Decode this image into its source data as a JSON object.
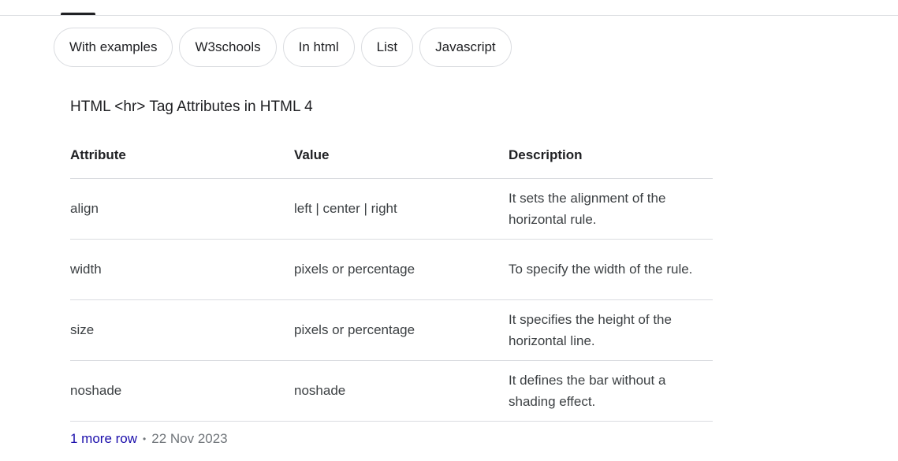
{
  "chips": [
    "With examples",
    "W3schools",
    "In html",
    "List",
    "Javascript"
  ],
  "heading": "HTML <hr> Tag Attributes in HTML 4",
  "table": {
    "headers": [
      "Attribute",
      "Value",
      "Description"
    ],
    "rows": [
      {
        "attribute": "align",
        "value": "left | center | right",
        "description": "It sets the alignment of the horizontal rule."
      },
      {
        "attribute": "width",
        "value": "pixels or percentage",
        "description": "To specify the width of the rule."
      },
      {
        "attribute": "size",
        "value": "pixels or percentage",
        "description": "It specifies the height of the horizontal line."
      },
      {
        "attribute": "noshade",
        "value": "noshade",
        "description": "It defines the bar without a shading effect."
      }
    ]
  },
  "footer": {
    "more_rows": "1 more row",
    "separator": "•",
    "date": "22 Nov 2023"
  }
}
